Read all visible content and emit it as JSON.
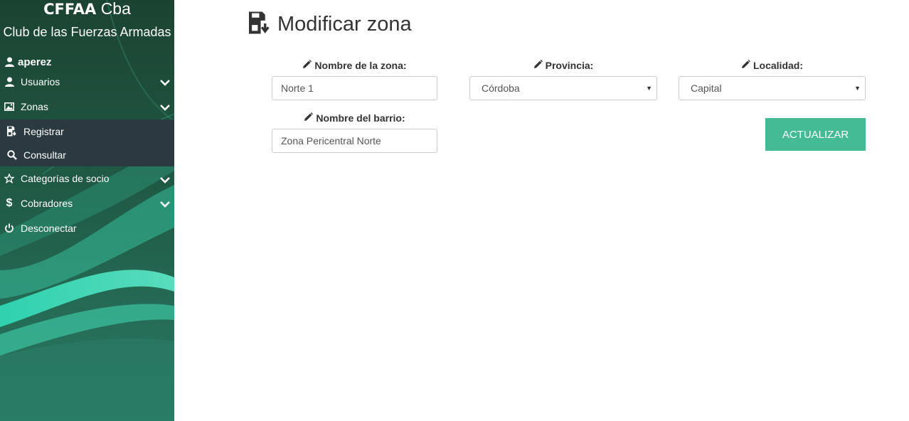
{
  "brand": {
    "title_bold": "CFFAA",
    "title_rest": "Cba",
    "subtitle": "Club de las Fuerzas Armadas"
  },
  "user": {
    "name": "aperez"
  },
  "nav": {
    "usuarios": "Usuarios",
    "zonas": "Zonas",
    "zonas_sub": {
      "registrar": "Registrar",
      "consultar": "Consultar"
    },
    "categorias": "Categorías de socio",
    "cobradores": "Cobradores",
    "desconectar": "Desconectar"
  },
  "page": {
    "title": "Modificar zona"
  },
  "form": {
    "nombre_zona": {
      "label": "Nombre de la zona:",
      "value": "Norte 1"
    },
    "provincia": {
      "label": "Provincia:",
      "value": "Córdoba"
    },
    "localidad": {
      "label": "Localidad:",
      "value": "Capital"
    },
    "nombre_barrio": {
      "label": "Nombre del barrio:",
      "value": "Zona Pericentral Norte"
    },
    "submit_label": "ACTUALIZAR"
  },
  "colors": {
    "sidebar": "#1f4a38",
    "submenu": "#2b3940",
    "accent": "#44bb94"
  }
}
